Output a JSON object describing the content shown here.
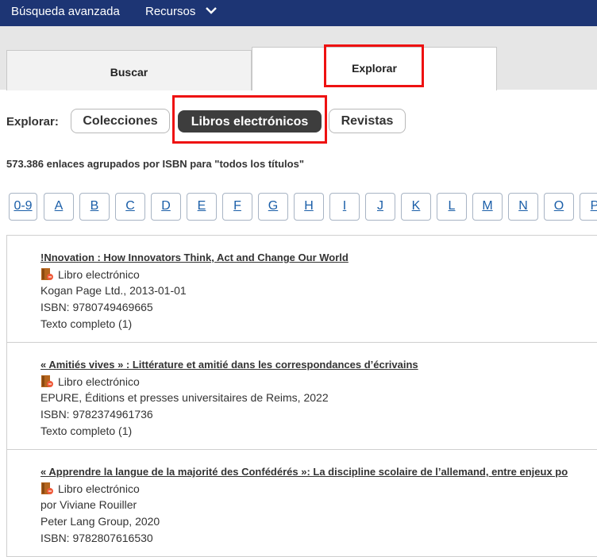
{
  "nav": {
    "advanced_search": "Búsqueda avanzada",
    "resources": "Recursos"
  },
  "tabs": {
    "search": "Buscar",
    "browse": "Explorar"
  },
  "browse_bar": {
    "label": "Explorar:",
    "options": [
      "Colecciones",
      "Libros electrónicos",
      "Revistas"
    ],
    "selected": "Libros electrónicos"
  },
  "count_text": "573.386 enlaces agrupados por ISBN para \"todos los títulos\"",
  "letters": [
    "0-9",
    "A",
    "B",
    "C",
    "D",
    "E",
    "F",
    "G",
    "H",
    "I",
    "J",
    "K",
    "L",
    "M",
    "N",
    "O",
    "P"
  ],
  "results": [
    {
      "title": "!Nnovation : How Innovators Think, Act and Change Our World",
      "type": "Libro electrónico",
      "lines": [
        "Kogan Page Ltd., 2013-01-01",
        "ISBN: 9780749469665",
        "Texto completo (1)"
      ]
    },
    {
      "title": "« Amitiés vives » : Littérature et amitié dans les correspondances d’écrivains",
      "type": "Libro electrónico",
      "lines": [
        "EPURE, Éditions et presses universitaires de Reims, 2022",
        "ISBN: 9782374961736",
        "Texto completo (1)"
      ]
    },
    {
      "title": "« Apprendre la langue de la majorité des Confédérés »: La discipline scolaire de l’allemand, entre enjeux po",
      "type": "Libro electrónico",
      "lines": [
        "por Viviane Rouiller",
        "Peter Lang Group, 2020",
        "ISBN: 9782807616530"
      ]
    }
  ],
  "colors": {
    "nav_bg": "#1d3574",
    "highlight": "#ee1111",
    "selected_pill": "#3d3d3d",
    "link": "#1a5ea8"
  },
  "icons": {
    "dropdown": "chevron-down-icon",
    "ebook": "ebook-icon"
  }
}
